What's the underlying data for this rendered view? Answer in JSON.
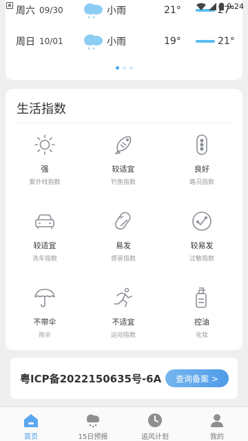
{
  "status_bar": {
    "time": "9:24",
    "app_badge": "A"
  },
  "forecast": {
    "rows": [
      {
        "weekday": "周六",
        "date": "09/30",
        "icon": "rain-cloud-icon",
        "condition": "小雨",
        "low": "21°",
        "high": "27°"
      },
      {
        "weekday": "周日",
        "date": "10/01",
        "icon": "rain-cloud-icon",
        "condition": "小雨",
        "low": "19°",
        "high": "21°"
      }
    ],
    "page_dots": 3,
    "active_dot": 0
  },
  "life_index": {
    "title": "生活指数",
    "items": [
      {
        "icon": "sun-icon",
        "value": "强",
        "label": "紫外线指数"
      },
      {
        "icon": "fish-icon",
        "value": "较适宜",
        "label": "钓鱼指数"
      },
      {
        "icon": "traffic-light-icon",
        "value": "良好",
        "label": "路况指数"
      },
      {
        "icon": "car-icon",
        "value": "较适宜",
        "label": "洗车指数"
      },
      {
        "icon": "pill-icon",
        "value": "易发",
        "label": "感冒指数"
      },
      {
        "icon": "allergy-icon",
        "value": "较易发",
        "label": "过敏指数"
      },
      {
        "icon": "umbrella-icon",
        "value": "不带伞",
        "label": "雨伞"
      },
      {
        "icon": "running-icon",
        "value": "不适宜",
        "label": "运动指数"
      },
      {
        "icon": "lotion-bottle-icon",
        "value": "控油",
        "label": "化妆"
      }
    ]
  },
  "icp": {
    "text": "粤ICP备2022150635号-6A",
    "button": "查询备案 >"
  },
  "tabs": [
    {
      "label": "首页",
      "icon": "home-icon",
      "active": true
    },
    {
      "label": "15日预报",
      "icon": "cloud-snow-icon",
      "active": false
    },
    {
      "label": "追风计划",
      "icon": "clock-icon",
      "active": false
    },
    {
      "label": "我的",
      "icon": "user-icon",
      "active": false
    }
  ],
  "colors": {
    "accent": "#4a9be8",
    "temp_bar": "#5bbdf3",
    "background": "#efefef"
  }
}
